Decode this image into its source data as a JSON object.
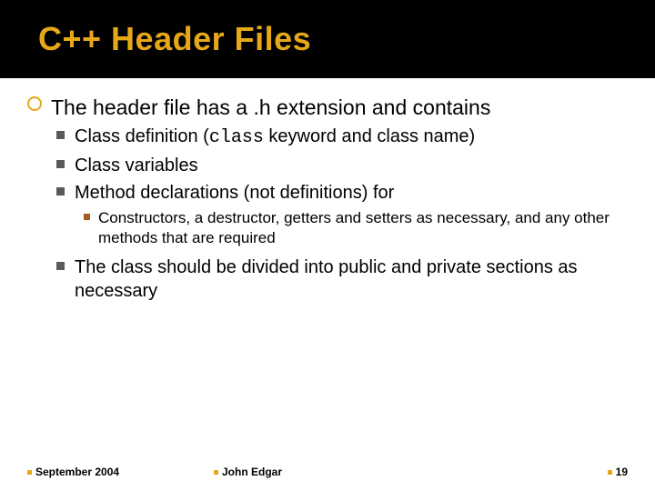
{
  "title": "C++ Header Files",
  "main": {
    "l1": "The header file has a .h extension and contains",
    "b1a": "Class definition (",
    "b1_code": "class",
    "b1b": " keyword and class name)",
    "b2": "Class variables",
    "b3": "Method declarations (not definitions) for",
    "s1": "Constructors, a destructor, getters and setters as necessary, and any other methods that are required",
    "b4": "The class should be divided into public and private sections as necessary"
  },
  "footer": {
    "date": "September 2004",
    "author": "John Edgar",
    "page": "19"
  }
}
